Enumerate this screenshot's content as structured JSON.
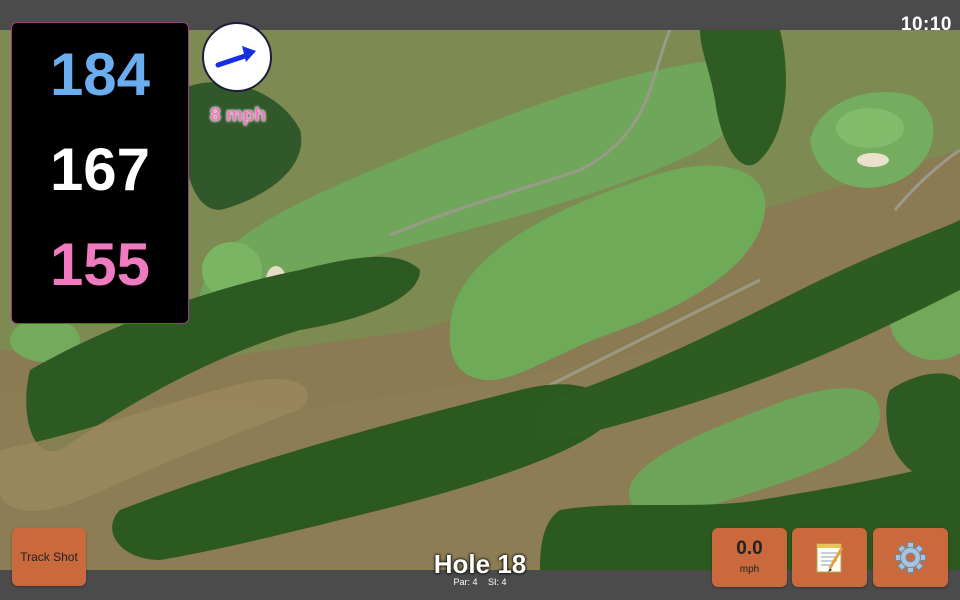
{
  "status_bar": {
    "time": "10:10"
  },
  "distances": {
    "back": "184",
    "center": "167",
    "front": "155"
  },
  "wind": {
    "speed": "8 mph",
    "direction_icon": "wind-arrow-icon",
    "arrow_color": "#1530e0"
  },
  "hole": {
    "title": "Hole 18",
    "par": "Par: 4",
    "stroke_index": "SI: 4"
  },
  "buttons": {
    "track_shot": "Track Shot",
    "speed_value": "0.0",
    "speed_unit": "mph",
    "notes_icon": "notepad-icon",
    "settings_icon": "gear-icon"
  },
  "colors": {
    "back_distance": "#6aaef0",
    "center_distance": "#ffffff",
    "front_distance": "#f07ac0",
    "button": "#c9693c",
    "bar": "#4b4b4b"
  }
}
